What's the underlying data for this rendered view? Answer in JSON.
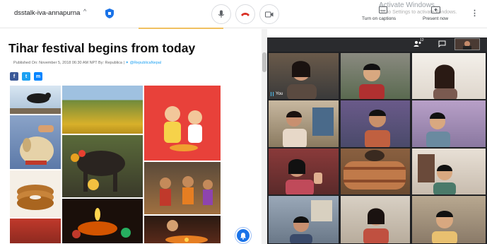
{
  "meeting": {
    "name": "dsstalk-iva-annapurna",
    "chevron": "^",
    "more": "⋮"
  },
  "watermark": {
    "title": "Activate Windows",
    "subtitle": "Go to Settings to activate Windows."
  },
  "controls": {
    "captions_label": "Turn on captions",
    "present_label": "Present now"
  },
  "article": {
    "title": "Tihar festival begins from today",
    "published": "Published On: November 5, 2018 06:30 AM NPT By: Republica",
    "separator": "|",
    "twitter_handle": "@RepublicaNepal"
  },
  "share": {
    "facebook": "f",
    "twitter": "t",
    "messenger": "m"
  },
  "participants": {
    "count": "12",
    "self_label": "You"
  },
  "colors": {
    "end_call": "#d93025",
    "meet_bg": "#202124",
    "accent_blue": "#1a73e8",
    "facebook": "#3b5998",
    "twitter": "#1da1f2",
    "messenger": "#0084ff"
  }
}
